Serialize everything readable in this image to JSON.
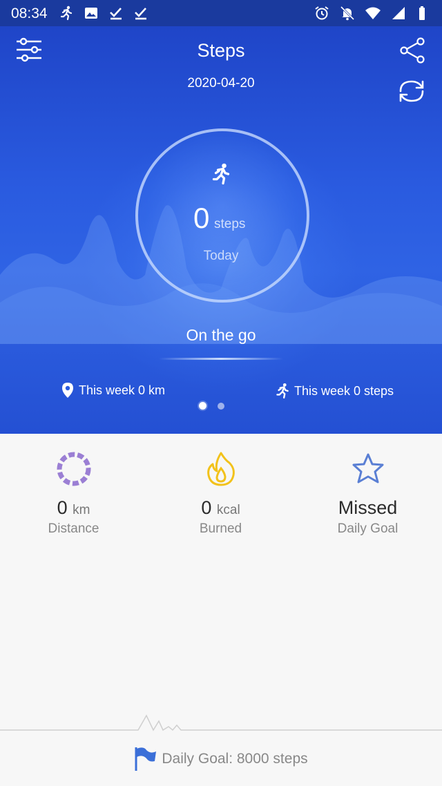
{
  "status_bar": {
    "time": "08:34",
    "left_icons": [
      "running-icon",
      "image-icon",
      "check-icon",
      "check-icon"
    ],
    "right_icons": [
      "alarm-icon",
      "bell-off-icon",
      "wifi-icon",
      "signal-icon",
      "battery-icon"
    ]
  },
  "header": {
    "title": "Steps",
    "date": "2020-04-20",
    "menu_icon": "sliders-icon",
    "share_icon": "share-icon",
    "sync_icon": "sync-icon"
  },
  "progress": {
    "steps": "0",
    "unit": "steps",
    "period": "Today",
    "icon": "running-icon"
  },
  "mode": {
    "label": "On the go"
  },
  "week": {
    "distance_label": "This week 0 km",
    "steps_label": "This week 0 steps"
  },
  "pager": {
    "count": 2,
    "active": 0
  },
  "stats": {
    "distance": {
      "value": "0",
      "unit": "km",
      "label": "Distance",
      "icon": "donut-icon"
    },
    "calories": {
      "value": "0",
      "unit": "kcal",
      "label": "Burned",
      "icon": "flame-icon"
    },
    "goal": {
      "value": "Missed",
      "label": "Daily Goal",
      "icon": "star-icon"
    }
  },
  "footer": {
    "goal_text": "Daily Goal: 8000 steps",
    "icon": "flag-icon"
  },
  "colors": {
    "hero": "#2a5be0",
    "status_bar": "#1a3a9e",
    "distance_icon": "#9b7fd4",
    "calories_icon": "#f2c21b",
    "goal_icon": "#5a7fd4",
    "flag_icon": "#3b6fd8"
  }
}
